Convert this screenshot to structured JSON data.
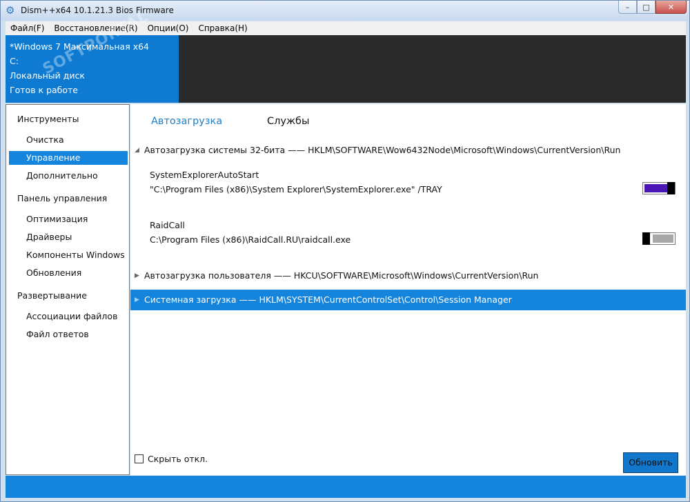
{
  "window": {
    "title": "Dism++x64 10.1.21.3 Bios Firmware",
    "minimize_label": "–",
    "maximize_label": "□",
    "close_label": "✕"
  },
  "menu": [
    "Файл(F)",
    "Восстановление(R)",
    "Опции(O)",
    "Справка(H)"
  ],
  "header": {
    "os": "*Windows 7 Максимальная x64",
    "drive": "C:",
    "disk": "Локальный диск",
    "status": "Готов к работе",
    "watermark": "SOFTPORTAL"
  },
  "sidebar": {
    "sections": [
      {
        "title": "Инструменты",
        "items": [
          "Очистка",
          "Управление загрузкой",
          "Дополнительно"
        ]
      },
      {
        "title": "Панель управления",
        "items": [
          "Оптимизация",
          "Драйверы",
          "Компоненты Windows",
          "Обновления"
        ]
      },
      {
        "title": "Развертывание",
        "items": [
          "Ассоциации файлов",
          "Файл ответов"
        ]
      }
    ],
    "active_item": "Управление загрузкой"
  },
  "tabs": [
    {
      "label": "Автозагрузка",
      "active": true
    },
    {
      "label": "Службы",
      "active": false
    }
  ],
  "groups": [
    {
      "label": "Автозагрузка системы 32-бита —— HKLM\\SOFTWARE\\Wow6432Node\\Microsoft\\Windows\\CurrentVersion\\Run",
      "expanded": true
    },
    {
      "label": "Автозагрузка пользователя —— HKCU\\SOFTWARE\\Microsoft\\Windows\\CurrentVersion\\Run",
      "expanded": false
    },
    {
      "label": "Системная загрузка —— HKLM\\SYSTEM\\CurrentControlSet\\Control\\Session Manager",
      "expanded": false,
      "selected": true
    }
  ],
  "entries": [
    {
      "name": "SystemExplorerAutoStart",
      "path": "\"C:\\Program Files (x86)\\System Explorer\\SystemExplorer.exe\" /TRAY",
      "enabled": true
    },
    {
      "name": "RaidCall",
      "path": "C:\\Program Files (x86)\\RaidCall.RU\\raidcall.exe",
      "enabled": false
    }
  ],
  "footer": {
    "hide_disabled_label": "Скрыть откл.",
    "refresh_label": "Обновить"
  },
  "colors": {
    "accent": "#1584dc",
    "toggle_on": "#4a17b5",
    "toggle_off": "#a8a8a8"
  }
}
